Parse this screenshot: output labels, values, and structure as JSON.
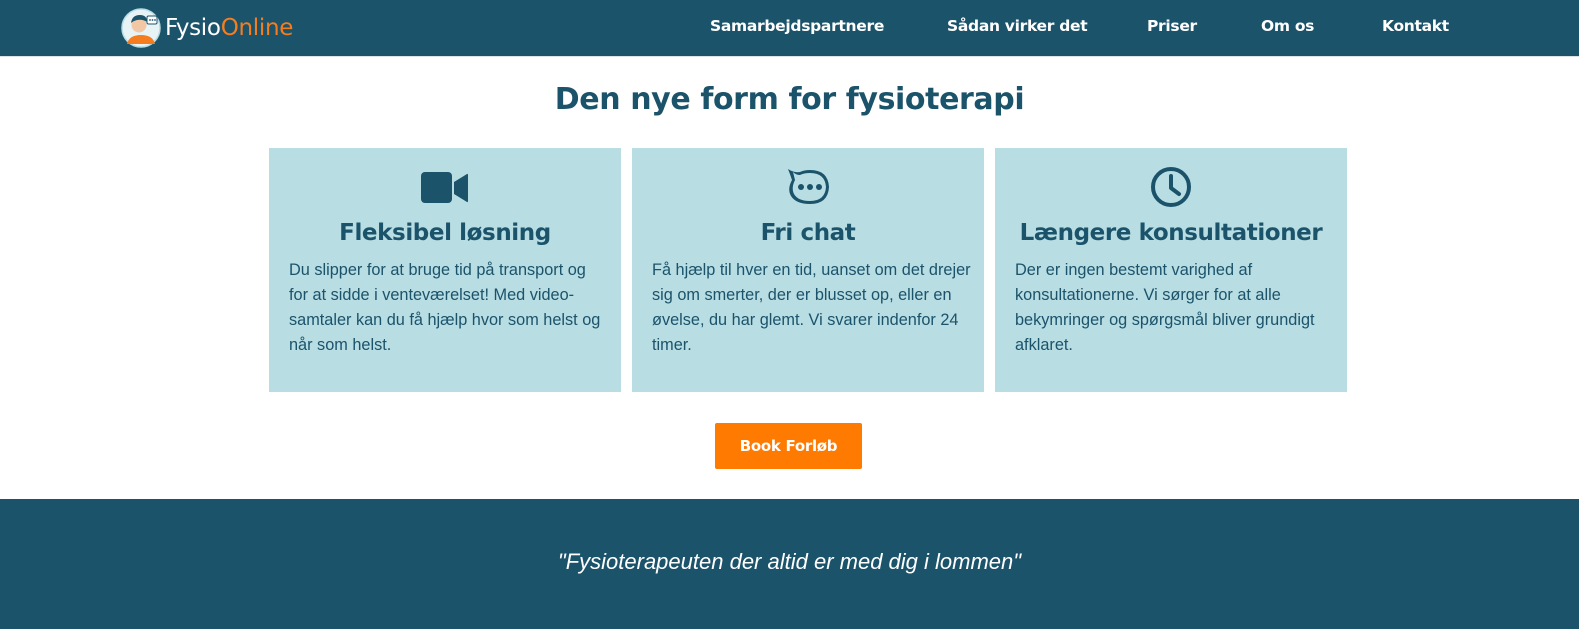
{
  "header": {
    "logo": {
      "part1": "Fysio",
      "part2": "Online"
    },
    "nav": [
      {
        "label": "Samarbejdspartnere"
      },
      {
        "label": "Sådan virker det"
      },
      {
        "label": "Priser"
      },
      {
        "label": "Om os"
      },
      {
        "label": "Kontakt"
      }
    ]
  },
  "main": {
    "title": "Den nye form for fysioterapi",
    "cards": [
      {
        "icon": "video-camera-icon",
        "title": "Fleksibel løsning",
        "text": "Du slipper for at bruge tid på transport og for at sidde i venteværelset! Med video-samtaler kan du få hjælp hvor som helst og når som helst."
      },
      {
        "icon": "chat-bubble-icon",
        "title": "Fri chat",
        "text": "Få hjælp til hver en tid, uanset om det drejer sig om smerter, der er blusset op, eller en øvelse, du har glemt. Vi svarer indenfor 24 timer."
      },
      {
        "icon": "clock-icon",
        "title": "Længere konsultationer",
        "text": "Der er ingen bestemt varighed af konsultationerne. Vi sørger for at alle bekymringer og spørgsmål bliver grundigt afklaret."
      }
    ],
    "book_button": "Book Forløb"
  },
  "footer": {
    "quote": "\"Fysioterapeuten der altid er med dig i lommen\""
  },
  "colors": {
    "primary": "#1b536b",
    "card_bg": "#b8dde3",
    "accent": "#ff7a00",
    "logo_accent": "#f57d1f"
  }
}
